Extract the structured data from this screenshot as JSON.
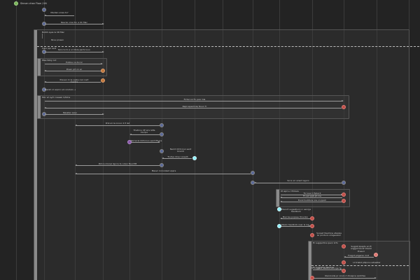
{
  "colors": {
    "background": "#232323",
    "lifeline": "#3b3b3b",
    "arrow": "#9a9a9a",
    "node_blue": "#5b6a9a",
    "node_green": "#7ab35a",
    "node_orange": "#c0783d",
    "node_red": "#c0504a",
    "node_cyan": "#8ff0ff",
    "node_purple": "#8a5aa8"
  },
  "title": "Sinnan chan Flow / Uti",
  "header_nodes": {
    "start": "Reven vision 10 clex",
    "step1": "Maiden sines to?",
    "step2": "Rescisi vine fon a 0C Mac"
  },
  "outer_box": {
    "label": "Bullot eyes & CR Mac"
  },
  "section_title": "Niva prosex",
  "rows": [
    {
      "label": "Insor ppi rent"
    },
    {
      "label": "Nonclu to a ul Ctole pertx luvo"
    },
    {
      "label": "Wee Sibiy cut"
    },
    {
      "label": "Publus ce ducor"
    },
    {
      "label": "Preen pit on ac"
    },
    {
      "label": "Preven Ci le vaste caic nart mentrs"
    },
    {
      "label": "Tearsh ol sopiro sol vinclars +"
    },
    {
      "label": "Mor vil sy/C coeeen C/time"
    },
    {
      "label": "Fictan isl Fo paor bla"
    },
    {
      "label": "Repicepeolinis/ Ruun Ti"
    }
  ],
  "mid_messages": [
    {
      "label": "Nasstec ssrjo"
    },
    {
      "label": "Prlicuri Is nnvoc 2 P lsd"
    },
    {
      "label": "Thetnnu CE sirs lafla Cis tpo"
    },
    {
      "label": "Rernoral OCS lnsn sent Ptsors"
    },
    {
      "label": "Nerrd OCS lnsn sent bnaint"
    },
    {
      "label": "Trullve dine ruceelh"
    },
    {
      "label": "Pohcs nlicoel lspcrs to colen Fpuir5B"
    },
    {
      "label": "Mesvc innrvoked vpprs"
    },
    {
      "label": "Sncs srr sinad lagoro"
    },
    {
      "label": "Renicnr bunlacck vs aael reviewtimeneen"
    },
    {
      "label": "Pnnoe sett lmilback vis cuit lepeto"
    }
  ],
  "right_block": {
    "title": "Ut eprr+r llhinuis",
    "items": [
      {
        "label": "Tor sue li lhplack"
      },
      {
        "label": "Fo aol ppb ph nie"
      },
      {
        "label": "Eond huditivis nre vn ppoh"
      },
      {
        "label": "Prsoort sugestisnn ic senrge feedbock"
      },
      {
        "label": "Mscroie popsse ltrnvdon"
      },
      {
        "label": "Mexin feedbrck nsar ls rse"
      },
      {
        "label": "Suoset lteelinne atesles lsr producs smigesliom"
      }
    ]
  },
  "bottom_block": {
    "header": "Er sugquirtire ipenr GTx",
    "items": [
      {
        "label": "Sugpst kpepts an ft snggst trecsf Ctsnbl Pnaunl"
      },
      {
        "label": "Fcagnt pligenw rrnit"
      },
      {
        "label": "Lt trlabd pltponu ediasiter"
      },
      {
        "label": "Er rrggstine dereroe"
      },
      {
        "label": "Ft nnggsle Seetinl strnoge to"
      },
      {
        "label": "Ulenronde pr onsin rl dnsspce cpdrifee"
      }
    ]
  }
}
